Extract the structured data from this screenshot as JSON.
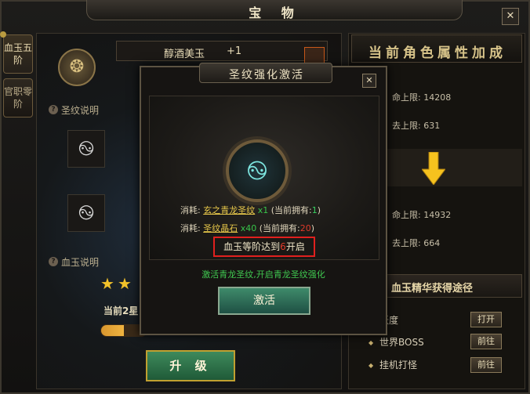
{
  "window": {
    "title": "宝 物",
    "close": "✕"
  },
  "side_tabs": [
    {
      "label": "血玉五阶"
    },
    {
      "label": "官职零阶"
    }
  ],
  "treasure": {
    "name": "醇酒美玉",
    "level": "+1"
  },
  "help": {
    "rune_help": "圣纹说明",
    "jade_help": "血玉说明"
  },
  "progress": {
    "stars_filled": 2,
    "stars_label": "当前2星",
    "fill_fraction": 0.25
  },
  "upgrade_button": "升 级",
  "right_panel": {
    "title": "当前角色属性加成",
    "before": [
      {
        "label": "命上限: 14208"
      },
      {
        "label": "去上限: 631"
      }
    ],
    "after": [
      {
        "label": "命上限: 14932"
      },
      {
        "label": "去上限: 664"
      }
    ],
    "sources_title": "血玉精华获得途径",
    "sources": [
      {
        "label": "跃度",
        "button": "打开"
      },
      {
        "label": "世界BOSS",
        "button": "前往"
      },
      {
        "label": "挂机打怪",
        "button": "前往"
      }
    ]
  },
  "popup": {
    "title": "圣纹强化激活",
    "close": "✕",
    "cost1_prefix": "消耗:",
    "cost1_item": "玄之青龙圣纹",
    "cost1_qty": "x1",
    "cost1_have_pre": "(当前拥有:",
    "cost1_have": "1",
    "cost1_have_post": ")",
    "cost2_prefix": "消耗:",
    "cost2_item": "圣纹晶石",
    "cost2_qty": "x40",
    "cost2_have_pre": "(当前拥有:",
    "cost2_have": "20",
    "cost2_have_post": ")",
    "requirement_pre": "血玉等阶达到",
    "requirement_num": "6",
    "requirement_post": "开启",
    "description": "激活青龙圣纹,开启青龙圣纹强化",
    "activate_button": "激活"
  },
  "colors": {
    "accent_gold": "#f2c22a",
    "status_green": "#38c44a",
    "warning_red": "#e03a2a"
  }
}
